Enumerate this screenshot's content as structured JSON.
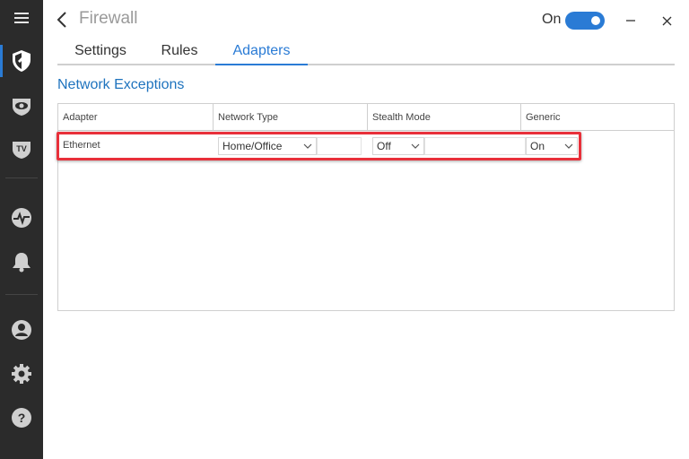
{
  "window": {
    "title": "Firewall"
  },
  "header": {
    "toggle_label": "On",
    "toggle_on": true
  },
  "sidebar": {
    "items": [
      {
        "icon": "menu-icon"
      },
      {
        "icon": "shield-icon",
        "active": true
      },
      {
        "icon": "eye-icon"
      },
      {
        "icon": "tv-icon"
      },
      {
        "icon": "activity-icon"
      },
      {
        "icon": "bell-icon"
      },
      {
        "icon": "user-icon"
      },
      {
        "icon": "gear-icon"
      },
      {
        "icon": "help-icon"
      }
    ]
  },
  "tabs": [
    {
      "label": "Settings",
      "active": false
    },
    {
      "label": "Rules",
      "active": false
    },
    {
      "label": "Adapters",
      "active": true
    }
  ],
  "section": {
    "title": "Network Exceptions"
  },
  "table": {
    "columns": [
      "Adapter",
      "Network Type",
      "Stealth Mode",
      "Generic"
    ],
    "rows": [
      {
        "adapter": "Ethernet",
        "network_type": "Home/Office",
        "stealth_mode": "Off",
        "generic": "On"
      }
    ]
  },
  "colors": {
    "accent": "#2a7bd5",
    "sidebar": "#2b2b2b",
    "highlight": "#e8303a",
    "section_title": "#1e73be"
  }
}
